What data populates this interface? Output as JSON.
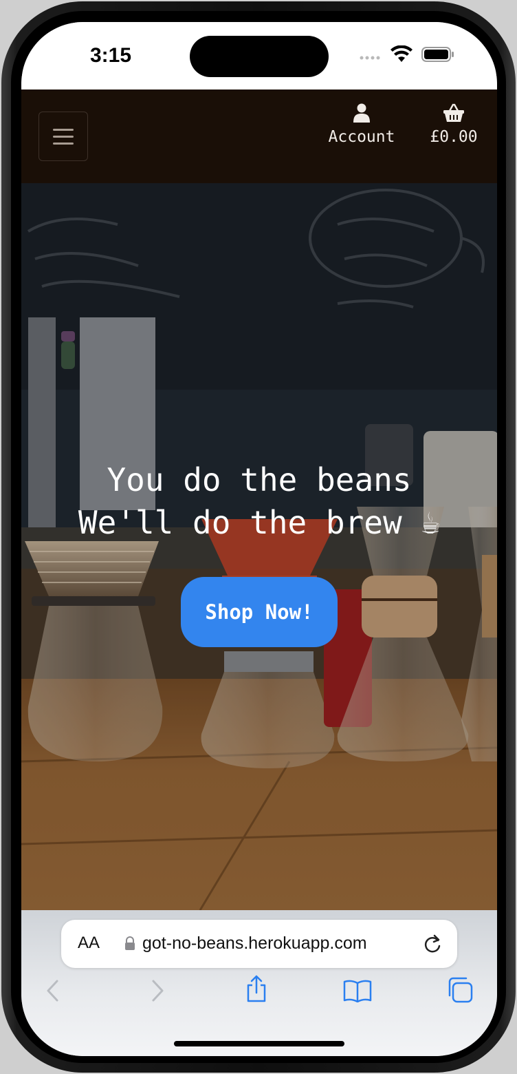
{
  "status_bar": {
    "time": "3:15"
  },
  "navbar": {
    "account_label": "Account",
    "basket_total": "£0.00"
  },
  "hero": {
    "line1": "You do the beans",
    "line2": "We'll do the brew ☕",
    "cta_label": "Shop Now!"
  },
  "browser": {
    "text_size_label": "AA",
    "url": "got-no-beans.herokuapp.com"
  },
  "colors": {
    "navbar_bg": "#1a0f07",
    "cta_bg": "#3385ee",
    "toolbar_icon": "#2a7ff0"
  }
}
